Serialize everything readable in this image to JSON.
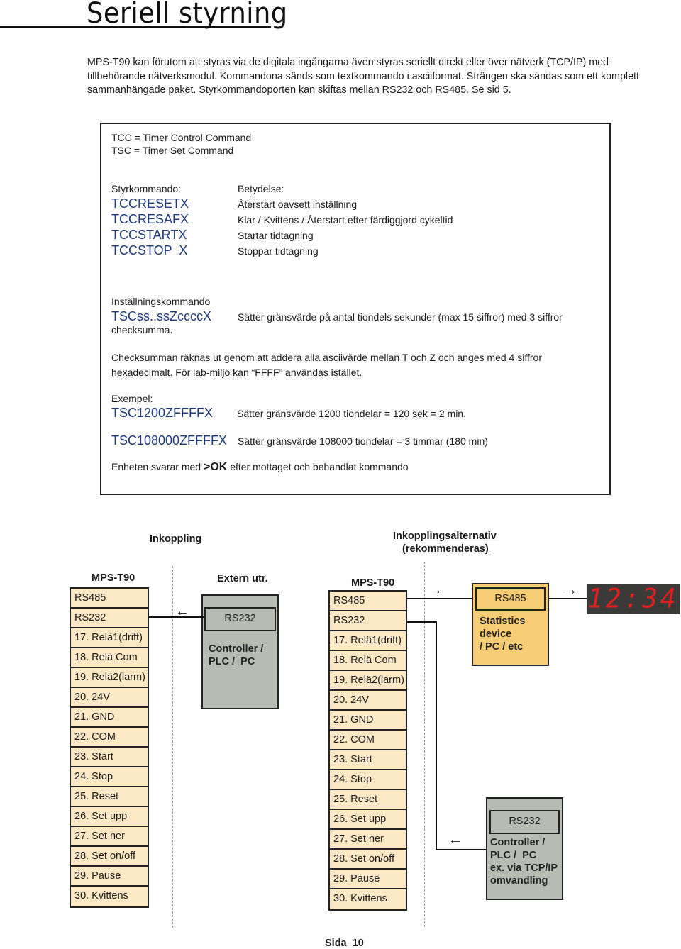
{
  "page": {
    "title": "Seriell styrning",
    "intro": "MPS-T90 kan förutom att styras via de digitala ingångarna även styras seriellt direkt eller över nätverk (TCP/IP) med tillbehörande nätverksmodul. Kommandona sänds som textkommando i asciiformat. Strängen ska sändas som ett komplett sammanhängade paket. Styrkommandoporten kan skiftas mellan RS232 och RS485. Se sid 5.",
    "page_number": "Sida  10"
  },
  "command_box": {
    "definitions": [
      "TCC = Timer Control Command",
      "TSC = Timer Set Command"
    ],
    "control_header": "Styrkommando:",
    "meaning_header": "Betydelse:",
    "control_commands": [
      {
        "command": "TCCRESETX",
        "meaning": "Återstart oavsett inställning"
      },
      {
        "command": "TCCRESAFX",
        "meaning": "Klar / Kvittens / Återstart efter färdiggjord cykeltid"
      },
      {
        "command": "TCCSTARTX",
        "meaning": "Startar tidtagning"
      },
      {
        "command": "TCCSTOP  X",
        "meaning": "Stoppar tidtagning"
      }
    ],
    "setting_header": "Inställningskommando",
    "setting_command": "TSCss..ssZccccX",
    "setting_meaning": "Sätter gränsvärde på antal tiondels sekunder (max 15 siffror) med 3 siffror",
    "setting_meaning_cont": "checksumma.",
    "checksum_line1": "Checksumman räknas ut genom att addera alla asciivärde mellan T och Z och anges med 4 siffror",
    "checksum_line2": "hexadecimalt. För lab-miljö kan “FFFF” användas istället.",
    "example_header": "Exempel:",
    "examples": [
      {
        "command": "TSC1200ZFFFFX",
        "meaning": "Sätter gränsvärde 1200 tiondelar = 120 sek = 2 min."
      },
      {
        "command": "TSC108000ZFFFFX",
        "meaning": "Sätter gränsvärde 108000 tiondelar = 3 timmar (180 min)"
      }
    ],
    "response_prefix": "Enheten svarar med ",
    "response_code": ">OK",
    "response_suffix": " efter mottaget och behandlat kommando"
  },
  "diagram": {
    "left_heading": "Inkoppling",
    "right_heading_line1": "Inkopplingsalternativ ",
    "right_heading_line2": "(rekommenderas)",
    "device_title": "MPS-T90",
    "terminals": [
      "RS485",
      "RS232",
      "17. Relä1(drift)",
      "18. Relä Com",
      "19. Relä2(larm)",
      "20. 24V",
      "21. GND",
      "22. COM",
      "23. Start",
      "24. Stop",
      "25. Reset",
      "26. Set upp",
      "27. Set ner",
      "28. Set on/off",
      "29. Pause",
      "30. Kvittens"
    ],
    "external_title": "Extern utr.",
    "external_port": "RS232",
    "external_label": "Controller /\nPLC /  PC",
    "stats_port": "RS485",
    "stats_label": "Statistics\ndevice\n/ PC / etc",
    "display_text": "12:34",
    "controller2_port": "RS232",
    "controller2_label": "Controller /\nPLC /  PC\nex. via TCP/IP\nomvandling",
    "arrow_left": "←",
    "arrow_right": "→"
  },
  "colors": {
    "command_blue": "#1f3a7a",
    "terminal_fill": "#fde8c6",
    "controller_fill": "#b6bcb4",
    "stats_fill": "#f6cc75",
    "display_bg": "#3a3a38",
    "display_digits": "#e02020"
  }
}
